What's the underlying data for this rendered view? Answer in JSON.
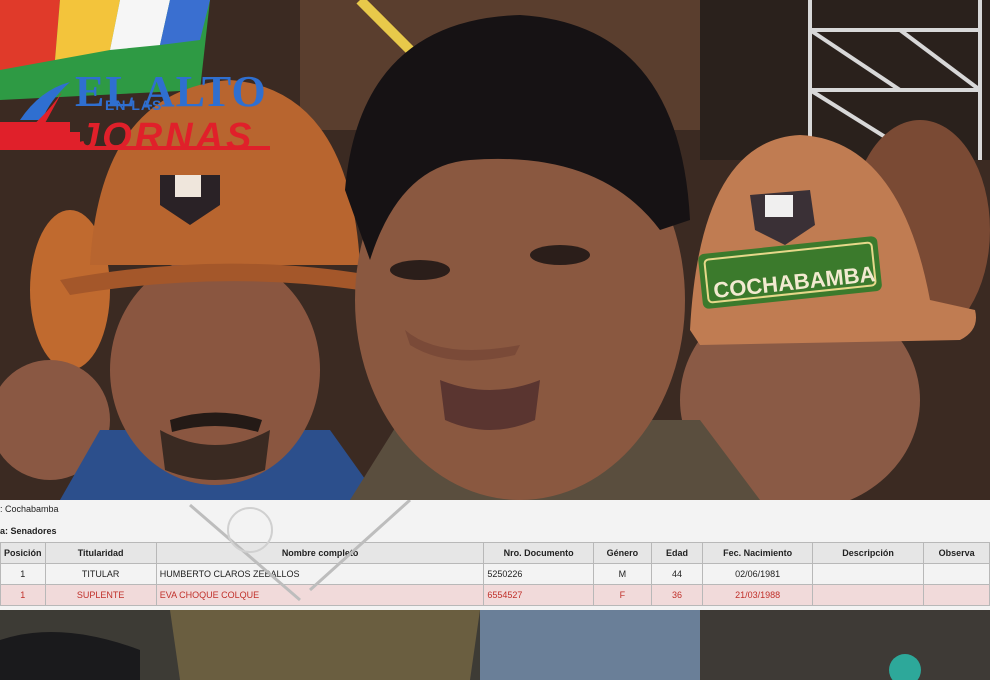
{
  "logo": {
    "line1": "EL ALTO",
    "line2": "EN LAS",
    "line3": "JORNAS"
  },
  "document": {
    "department_label": ": Cochabamba",
    "circunscription_label": "a: Senadores",
    "columns": [
      "Posición",
      "Titularidad",
      "Nombre completo",
      "Nro. Documento",
      "Género",
      "Edad",
      "Fec. Nacimiento",
      "Descripción",
      "Observa"
    ],
    "rows": [
      {
        "posicion": "1",
        "titularidad": "TITULAR",
        "nombre": "HUMBERTO CLAROS ZEBALLOS",
        "documento": "5250226",
        "genero": "M",
        "edad": "44",
        "nacimiento": "02/06/1981",
        "descripcion": "",
        "observacion": ""
      },
      {
        "posicion": "1",
        "titularidad": "SUPLENTE",
        "nombre": "EVA CHOQUE COLQUE",
        "documento": "6554527",
        "genero": "F",
        "edad": "36",
        "nacimiento": "21/03/1988",
        "descripcion": "",
        "observacion": ""
      }
    ]
  },
  "helmet_badge": "COCHABAMBA",
  "colors": {
    "logo_blue": "#2f6fd0",
    "logo_red": "#e0202a",
    "helmet": "#b8652f",
    "badge_green": "#3b7a2c"
  }
}
